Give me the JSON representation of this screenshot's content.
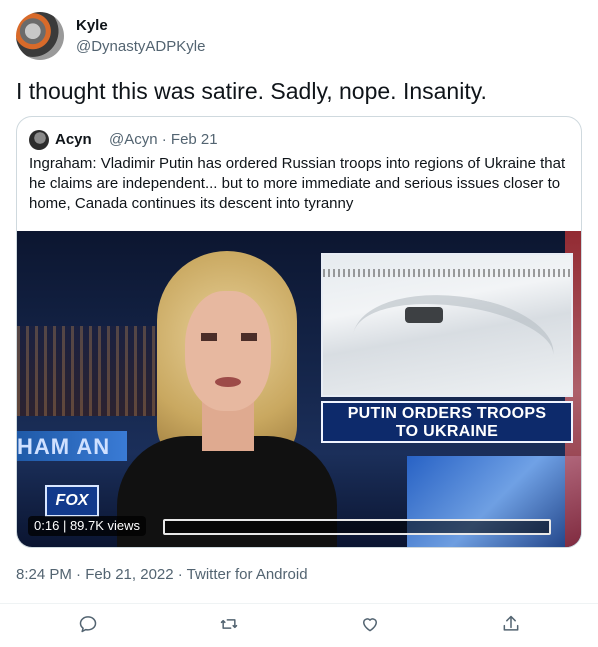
{
  "tweet": {
    "author_name": "Kyle",
    "author_handle": "@DynastyADPKyle",
    "text": "I thought this was satire. Sadly, nope.  Insanity.",
    "timestamp": "8:24 PM · Feb 21, 2022 · Twitter for Android"
  },
  "quoted_tweet": {
    "author_name": "Acyn",
    "author_handle": "@Acyn",
    "date": "Feb 21",
    "text": "Ingraham: Vladimir Putin has ordered Russian troops into regions of Ukraine that he claims are independent... but to more immediate and serious issues closer to home, Canada continues its descent into tyranny",
    "video": {
      "elapsed": "0:16",
      "views": "89.7K views",
      "progress_fraction": 0.0,
      "lower_third_line1": "PUTIN ORDERS TROOPS",
      "lower_third_line2": "TO UKRAINE",
      "channel_logo_text": "FOX",
      "background_text": "HAM AN"
    }
  },
  "actions": {
    "reply_icon": "reply-icon",
    "retweet_icon": "retweet-icon",
    "like_icon": "heart-icon",
    "share_icon": "share-icon"
  },
  "colors": {
    "accent": "#1d9bf0",
    "secondary_text": "#536471",
    "border": "#cfd9de"
  }
}
